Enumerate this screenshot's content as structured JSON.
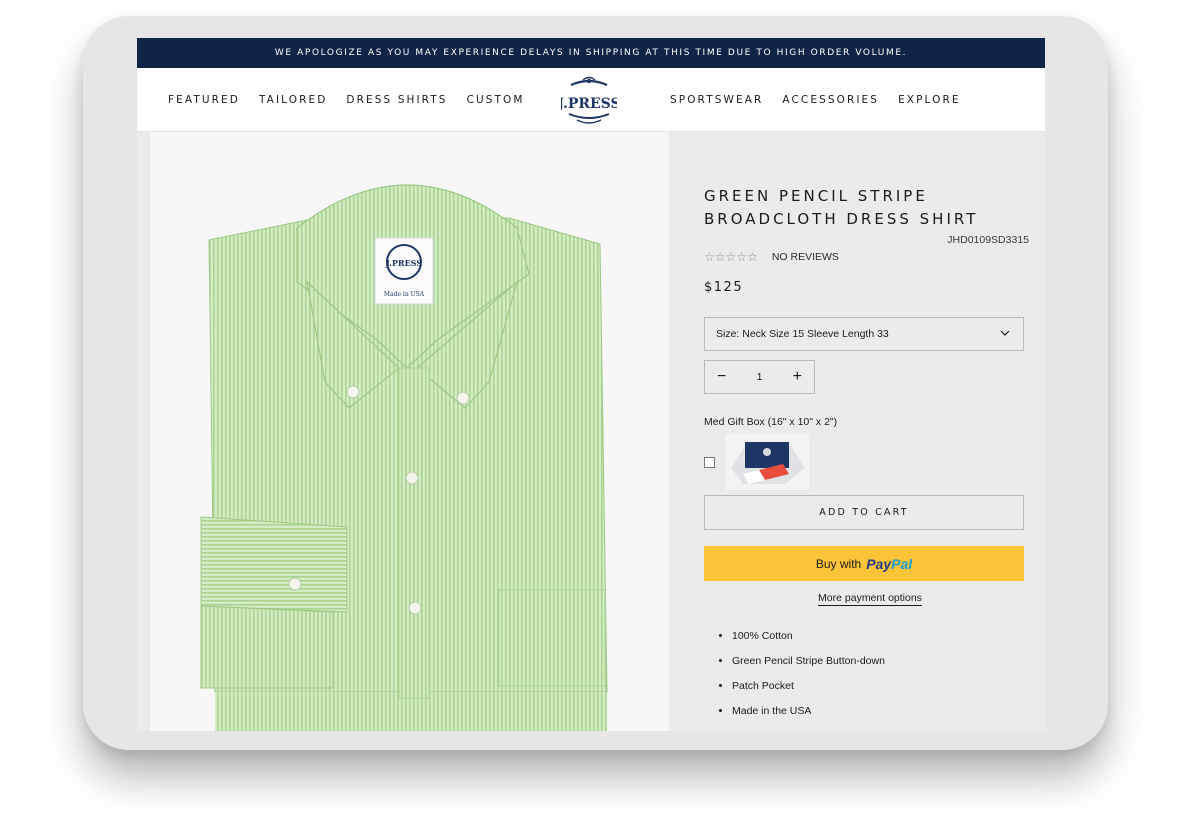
{
  "announcement": "WE APOLOGIZE AS YOU MAY EXPERIENCE DELAYS IN SHIPPING AT THIS TIME DUE TO HIGH ORDER VOLUME.",
  "nav": {
    "left": [
      "FEATURED",
      "TAILORED",
      "DRESS SHIRTS",
      "CUSTOM"
    ],
    "right": [
      "SPORTSWEAR",
      "ACCESSORIES",
      "EXPLORE"
    ]
  },
  "logo": {
    "text": "J.PRESS",
    "color": "#1f3566"
  },
  "product": {
    "title": "GREEN PENCIL STRIPE BROADCLOTH DRESS SHIRT",
    "sku": "JHD0109SD3315",
    "reviews_label": "NO REVIEWS",
    "rating": 0,
    "rating_max": 5,
    "price": "$125",
    "size_option": "Size: Neck Size 15 Sleeve Length 33",
    "quantity": "1",
    "gift_box_label": "Med Gift Box (16\" x 10\" x 2\")",
    "add_to_cart": "ADD TO CART",
    "paypal_prefix": "Buy with",
    "paypal_brand_a": "Pay",
    "paypal_brand_b": "Pal",
    "more_payment": "More payment options",
    "features": [
      "100% Cotton",
      "Green Pencil Stripe Button-down",
      "Patch Pocket",
      "Made in the USA"
    ],
    "shirt_label_text": "J.PRESS",
    "shirt_label_sub": "Made in USA"
  },
  "colors": {
    "announcement_bg": "#0f2447",
    "paypal_bg": "#fcc439",
    "shirt_green": "#bfe0a6",
    "info_bg": "#ebebeb"
  }
}
